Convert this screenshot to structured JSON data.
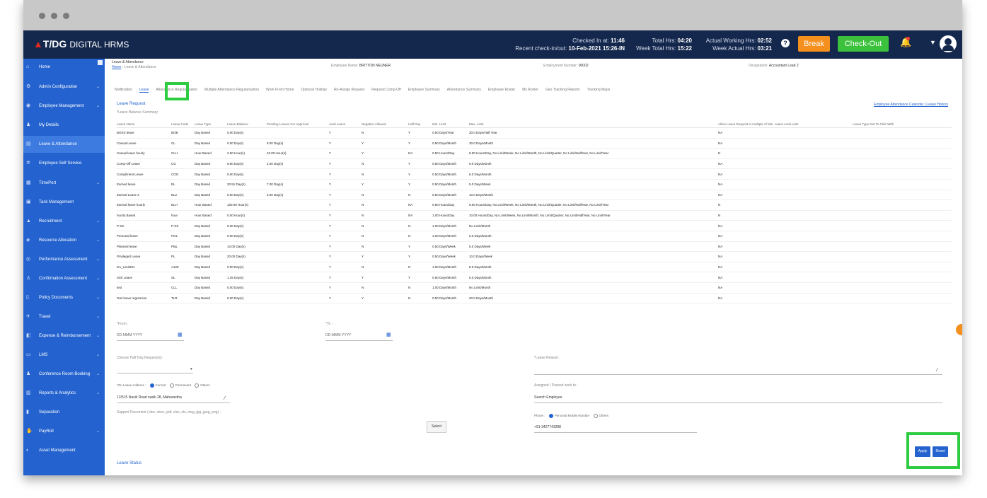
{
  "header": {
    "brand": "T/DG",
    "brand_sub": "DIGITAL HRMS",
    "checked_in_label": "Checked In at:",
    "checked_in_value": "11:46",
    "recent_label": "Recent check-in/out:",
    "recent_value": "10-Feb-2021 15:26-IN",
    "total_hrs_label": "Total Hrs:",
    "total_hrs_value": "04:20",
    "week_total_label": "Week Total Hrs:",
    "week_total_value": "15:22",
    "actual_label": "Actual Working Hrs:",
    "actual_value": "02:52",
    "week_actual_label": "Week Actual Hrs:",
    "week_actual_value": "03:21",
    "help": "?",
    "break_label": "Break",
    "checkout_label": "Check-Out",
    "bell": "🔔",
    "caret": "▼"
  },
  "sidebar": {
    "items": [
      {
        "label": "Home",
        "icon": "⌂",
        "chevron": ""
      },
      {
        "label": "Admin Configuration",
        "icon": "⚙",
        "chevron": "⌄"
      },
      {
        "label": "Employee Management",
        "icon": "◉",
        "chevron": "⌄"
      },
      {
        "label": "My Details",
        "icon": "♟",
        "chevron": ""
      },
      {
        "label": "Leave & Attendance",
        "icon": "▤",
        "chevron": ""
      },
      {
        "label": "Employee Self Service",
        "icon": "✲",
        "chevron": ""
      },
      {
        "label": "TimePort",
        "icon": "▦",
        "chevron": "⌄"
      },
      {
        "label": "Task Management",
        "icon": "▣",
        "chevron": ""
      },
      {
        "label": "Recruitment",
        "icon": "▲",
        "chevron": "⌄"
      },
      {
        "label": "Resource Allocation",
        "icon": "◈",
        "chevron": "⌄"
      },
      {
        "label": "Performance Assessment",
        "icon": "◎",
        "chevron": "⌄"
      },
      {
        "label": "Confirmation Assessment",
        "icon": "♙",
        "chevron": "⌄"
      },
      {
        "label": "Policy Documents",
        "icon": "▯",
        "chevron": "⌄"
      },
      {
        "label": "Travel",
        "icon": "✈",
        "chevron": "⌄"
      },
      {
        "label": "Expense & Reimbursement",
        "icon": "◧",
        "chevron": "⌄"
      },
      {
        "label": "LMS",
        "icon": "▭",
        "chevron": "⌄"
      },
      {
        "label": "Conference Room Booking",
        "icon": "♟",
        "chevron": "⌄"
      },
      {
        "label": "Reports & Analytics",
        "icon": "▥",
        "chevron": "⌄"
      },
      {
        "label": "Separation",
        "icon": "▮",
        "chevron": ""
      },
      {
        "label": "PayRoll",
        "icon": "✋",
        "chevron": "⌄"
      },
      {
        "label": "Asset Management",
        "icon": "◐",
        "chevron": ""
      }
    ]
  },
  "breadcrumb": {
    "title": "Leave & Attendance",
    "home": "Home",
    "current": "Leave & Attendance"
  },
  "employee": {
    "name_label": "Employee Name:",
    "name_value": "BRITTON NEUNER",
    "number_label": "Employment Number:",
    "number_value": "00002",
    "designation_label": "Designation:",
    "designation_value": "Accountant Lead 2"
  },
  "tabs": [
    "Notification",
    "Leave",
    "Attendance Regularisation",
    "Multiple Attendance Regularisation",
    "Work From Home",
    "Optional Holiday",
    "Re-Assign Request",
    "Request Comp-Off",
    "Employee Summary",
    "Attendance Summary",
    "Employee Roster",
    "My Roster",
    "Geo Tracking Reports",
    "Tracking Maps"
  ],
  "leave_request": {
    "title": "Leave Request",
    "summary_label": "*Leave Balance Summary:",
    "links": "Employee Attendance Calendar | Leave History"
  },
  "table": {
    "columns": [
      "Leave Name",
      "Leave Code",
      "Leave Type",
      "Leave Balance",
      "Pending Leaves For Approval",
      "Avail Leave",
      "Negative Allowed",
      "Half Day",
      "Min. Limit",
      "Max. Limit",
      "Allow Leave Request in multiple of Min. Leave Avail Limit",
      "Leave Type Not To Club With"
    ],
    "rows": [
      [
        "BOSS leave",
        "BOB",
        "Day Based",
        "0.00 Day(s)",
        "",
        "Y",
        "N",
        "Y",
        "0.50 Days/Year",
        "20.0 Days/Half Year",
        "NA",
        ""
      ],
      [
        "Casual Leave",
        "CL",
        "Day Based",
        "0.00 Day(s)",
        "8.00 Day(s)",
        "Y",
        "Y",
        "Y",
        "0.50 Days/Month",
        "30.0 Days/Month",
        "NA",
        ""
      ],
      [
        "Casual leave hourly",
        "CLH",
        "Hour Based",
        "2.50 Hour(s)",
        "40.00 Hour(s)",
        "Y",
        "Y",
        "NA",
        "0.50 Hours/Day",
        "9.00 Hours/Day, No Limit/Week, No Limit/Month, No Limit/Quarter, No Limit/HalfYear, No Limit/Year",
        "N",
        ""
      ],
      [
        "Comp-Off Leave",
        "CO",
        "Day Based",
        "9.50 Day(s)",
        "2.00 Day(s)",
        "Y",
        "N",
        "Y",
        "0.50 Days/Month",
        "6.0 Days/Month",
        "NA",
        ""
      ],
      [
        "Compliment Leave",
        "COO",
        "Day Based",
        "0.00 Day(s)",
        "",
        "Y",
        "N",
        "Y",
        "0.50 Days/Month",
        "6.0 Days/Month",
        "NA",
        ""
      ],
      [
        "Earned leave",
        "EL",
        "Day Based",
        "20.51 Day(s)",
        "7.00 Day(s)",
        "Y",
        "Y",
        "Y",
        "0.50 Days/Month",
        "5.0 Days/Week",
        "NA",
        ""
      ],
      [
        "Earned Leave 2",
        "EL2",
        "Day Based",
        "5.00 Day(s)",
        "5.00 Day(s)",
        "Y",
        "N",
        "N",
        "0.50 Days/Month",
        "10.0 Days/Month",
        "NA",
        ""
      ],
      [
        "Earned leave hourly",
        "ELH",
        "Hour Based",
        "100.00 Hour(s)",
        "",
        "Y",
        "N",
        "NA",
        "0.50 Hours/Day",
        "9.00 Hours/Day, No Limit/Week, No Limit/Month, No Limit/Quarter, No Limit/HalfYear, No Limit/Year",
        "N",
        ""
      ],
      [
        "hourly Based",
        "hour",
        "Hour Based",
        "0.00 Hour(s)",
        "",
        "Y",
        "N",
        "NA",
        "1.00 Hours/Day",
        "10.00 Hours/Day, No Limit/Week, No Limit/Month, No Limit/Quarter, No Limit/HalfYear, No Limit/Year",
        "N",
        ""
      ],
      [
        "P-KK",
        "P-KK",
        "Day Based",
        "0.00 Day(s)",
        "",
        "Y",
        "N",
        "N",
        "1.00 Days/Month",
        "No Limit/Month",
        "NA",
        ""
      ],
      [
        "Personal leave",
        "PerL",
        "Day Based",
        "0.00 Day(s)",
        "",
        "Y",
        "N",
        "N",
        "1.00 Days/Month",
        "5.0 Days/Month",
        "NA",
        ""
      ],
      [
        "Planned leave",
        "PlaL",
        "Day Based",
        "10.00 Day(s)",
        "",
        "Y",
        "N",
        "Y",
        "0.50 Days/Week",
        "5.0 Days/Week",
        "NA",
        ""
      ],
      [
        "Privileged Leave",
        "PL",
        "Day Based",
        "20.00 Day(s)",
        "",
        "Y",
        "Y",
        "Y",
        "0.50 Days/Week",
        "10.0 Days/Week",
        "NA",
        ""
      ],
      [
        "sm_Limit201",
        "A128",
        "Day Based",
        "0.00 Day(s)",
        "",
        "Y",
        "N",
        "N",
        "1.00 Days/Month",
        "8.0 Days/Month",
        "NA",
        ""
      ],
      [
        "Sick Leave",
        "SL",
        "Day Based",
        "1.25 Day(s)",
        "",
        "Y",
        "Y",
        "Y",
        "0.50 Days/Month",
        "5.0 Days/Month",
        "NA",
        ""
      ],
      [
        "test",
        "CLL",
        "Day Based",
        "0.00 Day(s)",
        "",
        "Y",
        "N",
        "N",
        "1.00 Days/Month",
        "No Limit/Month",
        "NA",
        ""
      ],
      [
        "Test leave regression",
        "TLR",
        "Day Based",
        "0.00 Day(s)",
        "",
        "Y",
        "Y",
        "N",
        "0.50 Days/Month",
        "20.0 Days/Month",
        "NA",
        ""
      ]
    ]
  },
  "form": {
    "from_label": "*From :",
    "from_placeholder": "DD-MMM-YYYY",
    "to_label": "*To :",
    "to_placeholder": "DD-MMM-YYYY",
    "half_day_label": "Choose Half Day Request(s) :",
    "reason_label": "*Leave Reason :",
    "address_label": "*On Leave Address :",
    "address_current": "Current",
    "address_permanent": "Permanent",
    "address_others": "Others",
    "address_value": "12/515 Nasik Road nasik 28, Maharastha",
    "assigned_label": "Assigned / Passed work to :",
    "assigned_value": "Search Employee",
    "support_label": "Support Document (.doc,.docx,.pdf,.xlsx,.xls,.msg,.jpg,.jpeg,.png) :",
    "select_label": "Select",
    "phone_label": "Phone :",
    "phone_personal": "Personal Mobile Number",
    "phone_others": "Others",
    "phone_value": "+91-3427743288",
    "apply_label": "Apply",
    "reset_label": "Reset",
    "leave_status": "Leave Status"
  },
  "colors": {
    "topbar": "#14284d",
    "sidebar": "#2463cf",
    "break": "#f5901e",
    "checkout": "#3cc13c",
    "highlight": "#2ecc40"
  }
}
